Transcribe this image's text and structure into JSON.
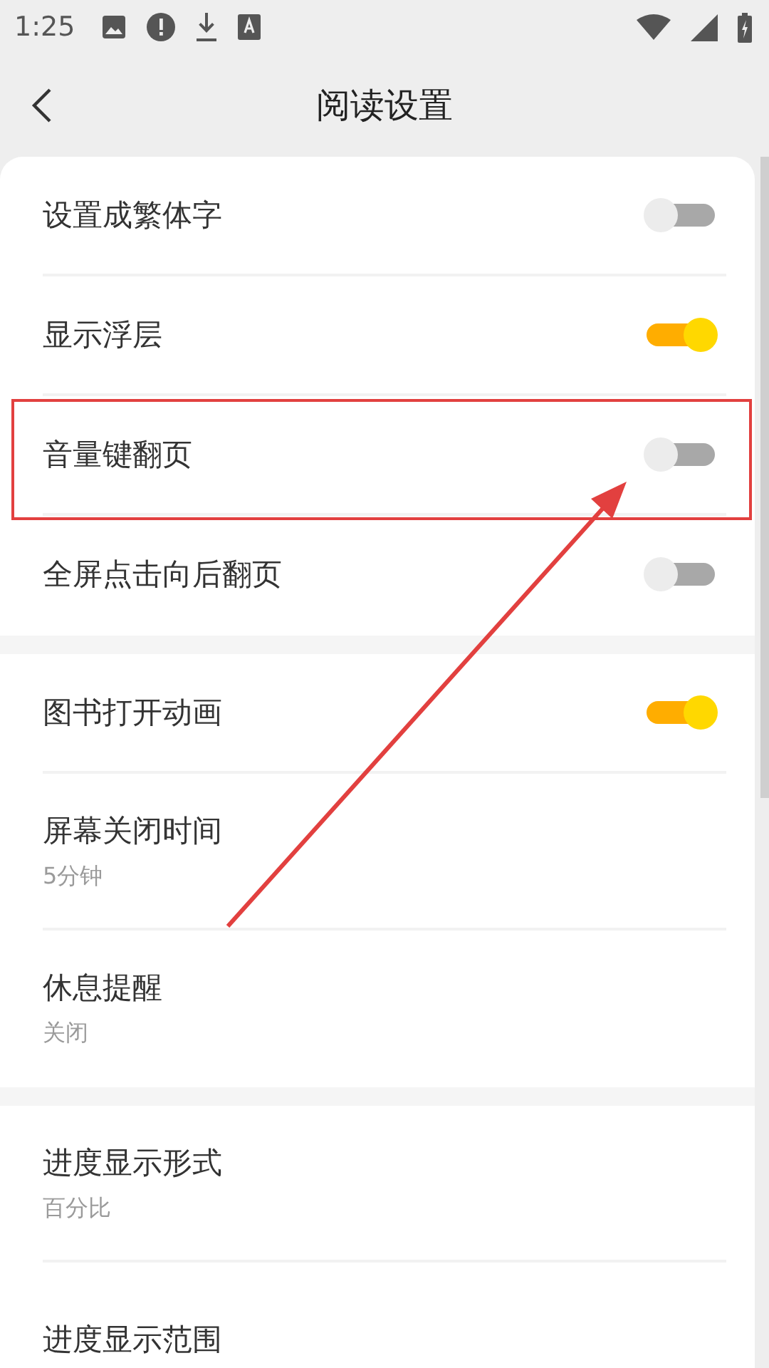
{
  "status_bar": {
    "time": "1:25"
  },
  "header": {
    "title": "阅读设置"
  },
  "sections": [
    {
      "items": [
        {
          "kind": "toggle",
          "label": "设置成繁体字",
          "on": false,
          "highlighted": false
        },
        {
          "kind": "toggle",
          "label": "显示浮层",
          "on": true,
          "highlighted": false
        },
        {
          "kind": "toggle",
          "label": "音量键翻页",
          "on": false,
          "highlighted": true
        },
        {
          "kind": "toggle",
          "label": "全屏点击向后翻页",
          "on": false,
          "highlighted": false
        }
      ]
    },
    {
      "items": [
        {
          "kind": "toggle",
          "label": "图书打开动画",
          "on": true,
          "highlighted": false
        },
        {
          "kind": "value",
          "label": "屏幕关闭时间",
          "value": "5分钟",
          "highlighted": false
        },
        {
          "kind": "value",
          "label": "休息提醒",
          "value": "关闭",
          "highlighted": false
        }
      ]
    },
    {
      "items": [
        {
          "kind": "value",
          "label": "进度显示形式",
          "value": "百分比",
          "highlighted": false
        },
        {
          "kind": "value",
          "label": "进度显示范围",
          "highlighted": false
        }
      ]
    }
  ]
}
